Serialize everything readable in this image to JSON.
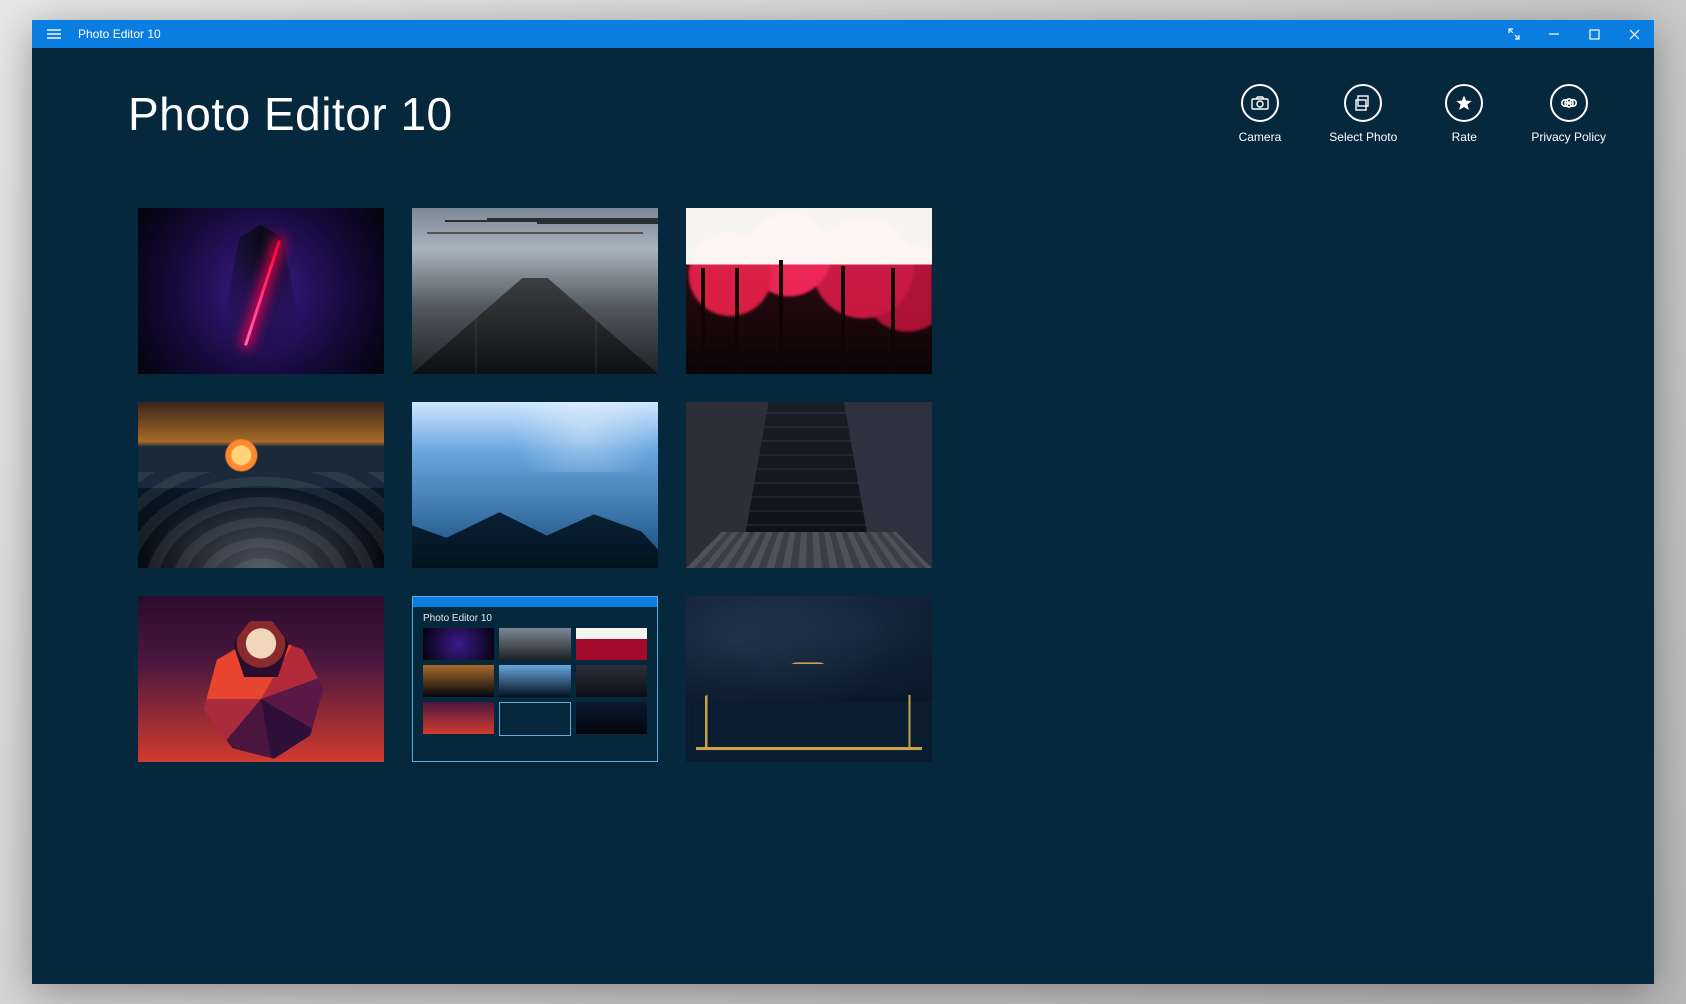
{
  "window": {
    "title": "Photo Editor 10"
  },
  "header": {
    "app_title": "Photo Editor 10"
  },
  "toolbar": {
    "camera_label": "Camera",
    "select_label": "Select Photo",
    "rate_label": "Rate",
    "privacy_label": "Privacy Policy"
  },
  "meta_thumbnail": {
    "label": "Photo Editor 10"
  }
}
